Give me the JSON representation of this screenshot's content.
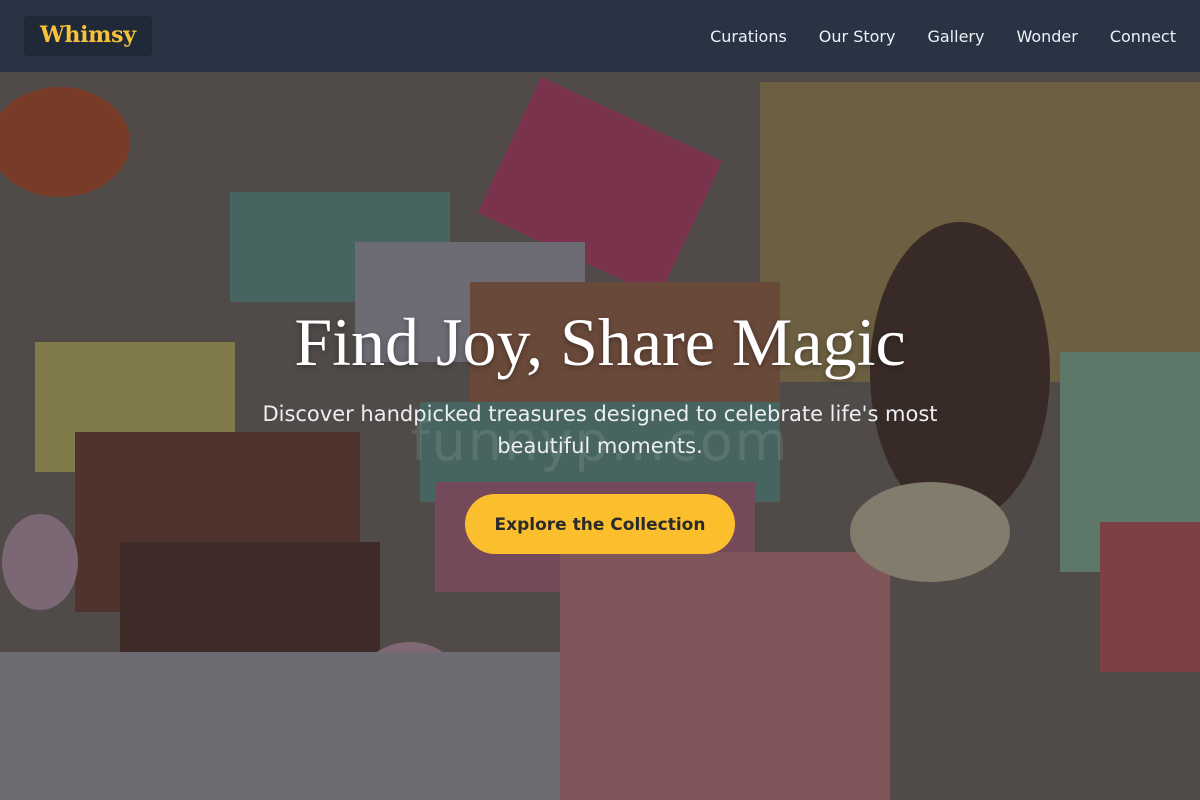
{
  "brand": {
    "logo_text": "Whimsy",
    "accent_color": "#fbbf2d"
  },
  "nav": {
    "items": [
      {
        "label": "Curations"
      },
      {
        "label": "Our Story"
      },
      {
        "label": "Gallery"
      },
      {
        "label": "Wonder"
      },
      {
        "label": "Connect"
      }
    ]
  },
  "hero": {
    "title": "Find Joy, Share Magic",
    "subtitle": "Discover handpicked treasures designed to celebrate life's most beautiful moments.",
    "cta_label": "Explore the Collection",
    "watermark_text": "funnyp...com",
    "background_image": "photo of colorful handmade soap bars, pine cone and candy sprinkles"
  }
}
